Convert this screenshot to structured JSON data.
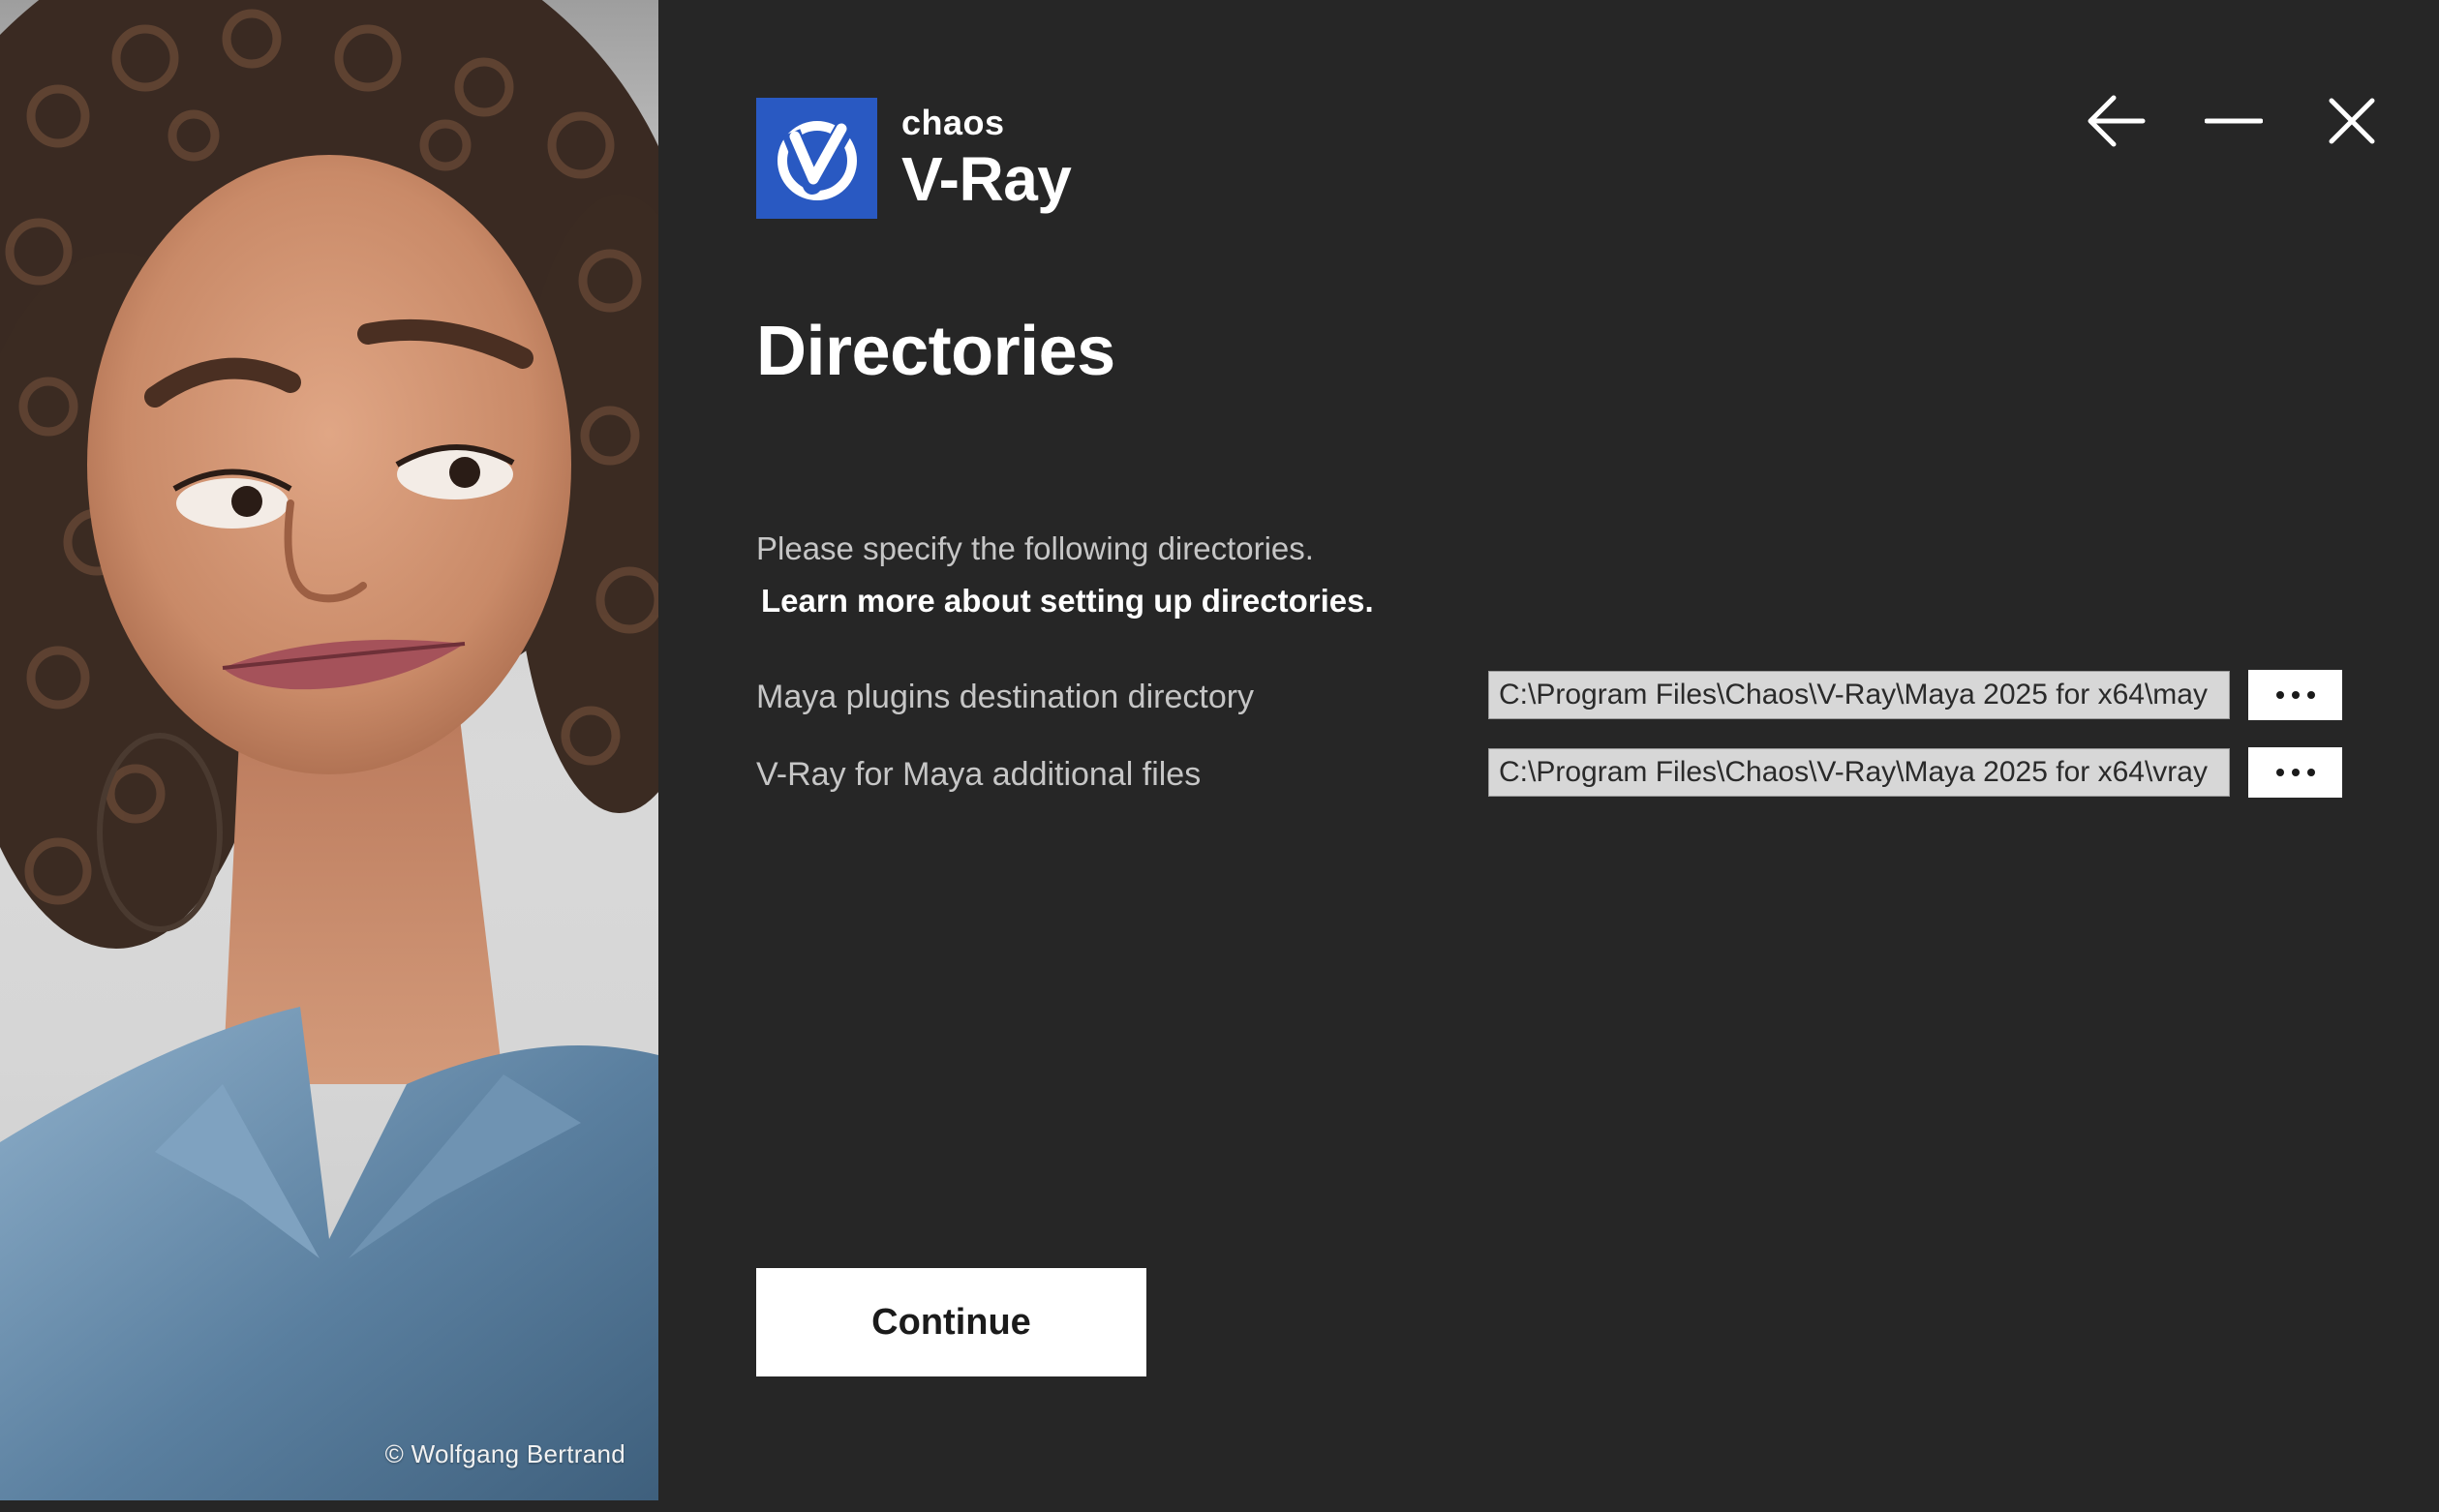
{
  "artwork": {
    "credit": "© Wolfgang Bertrand"
  },
  "logo": {
    "brand": "chaos",
    "product": "V-Ray",
    "mark_color": "#2959c2",
    "icon": "vray-v-icon"
  },
  "window_controls": {
    "back_icon": "arrow-left-icon",
    "minimize_icon": "minimize-icon",
    "close_icon": "close-icon"
  },
  "page": {
    "title": "Directories",
    "description": "Please specify the following directories.",
    "learn_more_link": "Learn more about setting up directories."
  },
  "directories": [
    {
      "label": "Maya plugins destination directory",
      "value": "C:\\Program Files\\Chaos\\V-Ray\\Maya 2025 for x64\\may",
      "browse_icon": "more-dots-icon"
    },
    {
      "label": "V-Ray for Maya additional files",
      "value": "C:\\Program Files\\Chaos\\V-Ray\\Maya 2025 for x64\\vray",
      "browse_icon": "more-dots-icon"
    }
  ],
  "actions": {
    "continue_label": "Continue"
  },
  "colors": {
    "background": "#262626",
    "accent": "#2959c2",
    "text_primary": "#ffffff",
    "text_secondary": "#c6c6c6"
  }
}
